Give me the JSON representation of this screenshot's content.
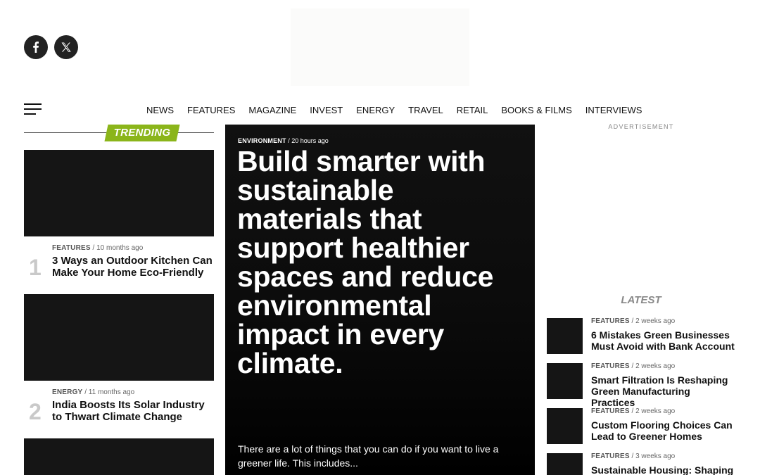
{
  "social": [
    {
      "name": "facebook-icon"
    },
    {
      "name": "x-icon"
    }
  ],
  "nav": {
    "items": [
      "NEWS",
      "FEATURES",
      "MAGAZINE",
      "INVEST",
      "ENERGY",
      "TRAVEL",
      "RETAIL",
      "BOOKS & FILMS",
      "INTERVIEWS"
    ]
  },
  "trending": {
    "heading": "TRENDING",
    "accent_color": "#8bb51a",
    "items": [
      {
        "rank": "1",
        "category": "FEATURES",
        "time": "10 months ago",
        "title": "3 Ways an Outdoor Kitchen Can Make Your Home Eco-Friendly"
      },
      {
        "rank": "2",
        "category": "ENERGY",
        "time": "11 months ago",
        "title": "India Boosts Its Solar Industry to Thwart Climate Change"
      }
    ]
  },
  "feature": {
    "category": "ENVIRONMENT",
    "time": "20 hours ago",
    "title": "Build smarter with sustainable materials that support healthier spaces and reduce environmental impact in every climate.",
    "excerpt": "There are a lot of things that you can do if you want to live a greener life. This includes..."
  },
  "sidebar": {
    "ad_label": "ADVERTISEMENT",
    "latest_heading": "LATEST",
    "latest": [
      {
        "category": "FEATURES",
        "time": "2 weeks ago",
        "title": "6 Mistakes Green Businesses Must Avoid with Bank Account"
      },
      {
        "category": "FEATURES",
        "time": "2 weeks ago",
        "title": "Smart Filtration Is Reshaping Green Manufacturing Practices"
      },
      {
        "category": "FEATURES",
        "time": "2 weeks ago",
        "title": "Custom Flooring Choices Can Lead to Greener Homes"
      },
      {
        "category": "FEATURES",
        "time": "3 weeks ago",
        "title": "Sustainable Housing: Shaping"
      }
    ]
  },
  "separator": "/"
}
